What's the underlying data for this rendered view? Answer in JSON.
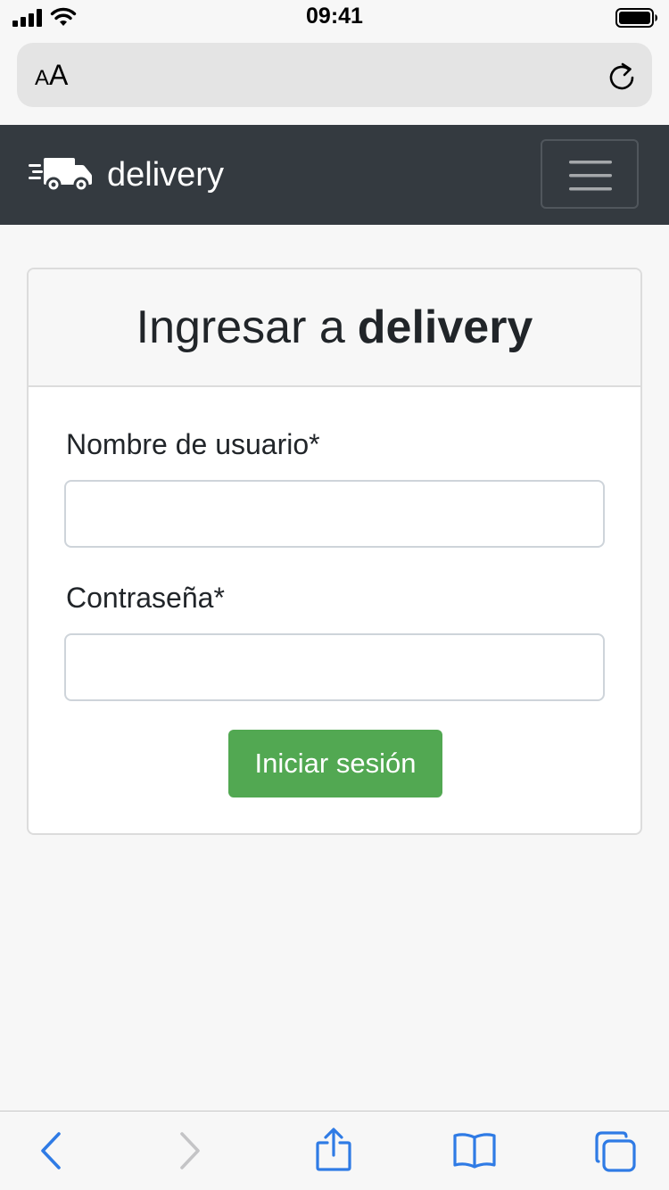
{
  "status_bar": {
    "time": "09:41"
  },
  "address_bar": {
    "aa_small": "A",
    "aa_large": "A",
    "reload_icon": "reload-icon"
  },
  "navbar": {
    "brand": "delivery",
    "brand_icon": "truck-icon",
    "toggler_icon": "hamburger-icon",
    "background": "#343a40"
  },
  "login_card": {
    "title_prefix": "Ingresar a",
    "title_brand": "delivery",
    "username_label": "Nombre de usuario*",
    "username_value": "",
    "password_label": "Contraseña*",
    "password_value": "",
    "submit_label": "Iniciar sesión",
    "submit_color": "#52a852"
  },
  "toolbar": {
    "icons": [
      "back-icon",
      "forward-icon",
      "share-icon",
      "bookmarks-icon",
      "tabs-icon"
    ],
    "accent": "#2f7be5"
  }
}
